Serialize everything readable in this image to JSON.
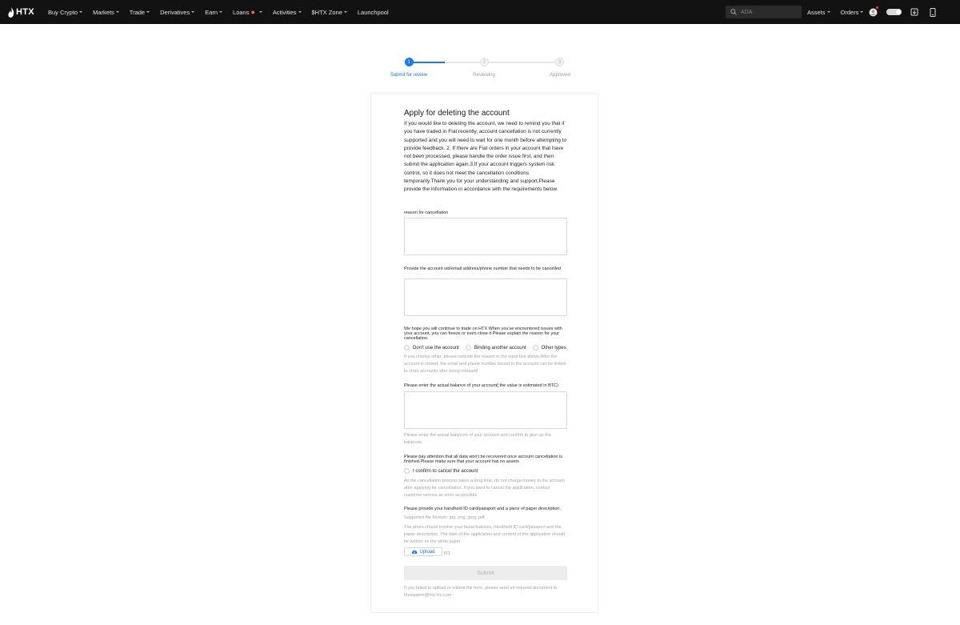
{
  "header": {
    "logo": "HTX",
    "nav": [
      "Buy Crypto",
      "Markets",
      "Trade",
      "Derivatives",
      "Earn",
      "Loans",
      "Activities",
      "$HTX Zone",
      "Launchpool"
    ],
    "search_placeholder": "ADA",
    "right_nav": [
      "Assets",
      "Orders"
    ]
  },
  "steps": [
    {
      "num": "1",
      "label": "Submit for review"
    },
    {
      "num": "2",
      "label": "Reviewing"
    },
    {
      "num": "3",
      "label": "Approved"
    }
  ],
  "form": {
    "title": "Apply for deleting the account",
    "intro": "If you would like to deleting the account, we need to remind you that if you have traded in Fiat recently, account cancellation is not currently supported and you will need to wait for one month before attempting to provide feedback. 2. If there are Fiat orders in your account that have not been processed, please handle the order issue first, and then submit the application again.3.If your account triggers system risk control, so it does not meet the cancellation conditions temporarily.Thank you for your understanding and support.Please provide the information in accordance with the requirements below:",
    "reason_label": "reason for cancellation",
    "account_label": "Provide the account uid/email address/phone number that needs to be cancelled",
    "hope_label": "We hope you will continue to trade on HTX When you've encountered issues with your account, you can freeze or even close it Please explain the reason for your cancellation.",
    "options": [
      "Don't use the account",
      "Binding another account",
      "Other types"
    ],
    "options_hint": "If you choose other, please indicate the reason in the input box above.After the account is closed, the email and phone number bound to the account can be linked to other accounts after being released",
    "balance_label": "Please enter the actual balance of your account( the value is estimated in BTC)",
    "balance_hint": "Please enter the actual balances of your account and confirm to give up the balances.",
    "attention_label": "Please pay attention that all data won't be recovered once account cancellation is finished.Please make sure that your account has no assets",
    "confirm_label": "I confirm to cancel the account",
    "confirm_hint": "As the cancellation process takes a long time, do not charge money to the account after applying for cancellation. If you want to cancel the application, contact customer service as soon as possible",
    "id_label": "Please provide your handheld ID card/passport and a piece of paper description.",
    "formats_hint": "Supported file formats: jpg, png, jpeg, pdf",
    "photo_hint": "The photo should involve your facial features, handheld ID card/passport and the paper description. The date of the application and content of the application should be written on the white paper",
    "upload_label": "Upload",
    "upload_count": "0/1",
    "submit_label": "Submit",
    "footer_hint": "If you failed to upload or submit the form, please send all required document to htxsupport@htx-inc.com"
  },
  "colors": {
    "accent": "#1677ff",
    "topbar": "#121212"
  }
}
